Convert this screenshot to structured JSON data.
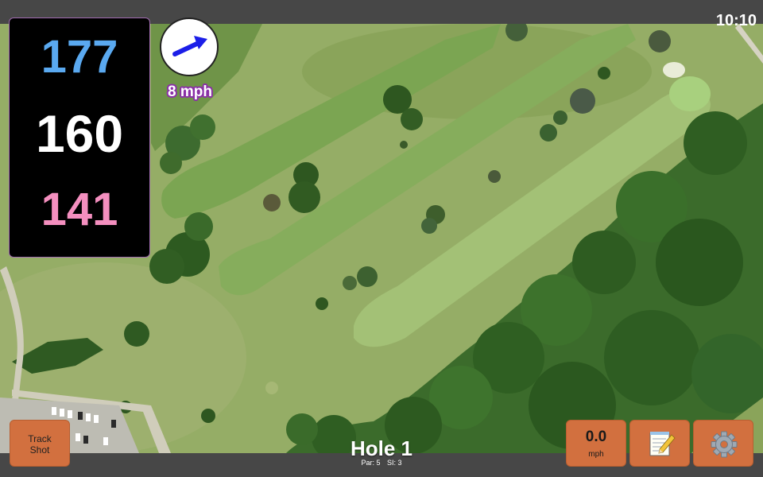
{
  "status": {
    "time": "10:10"
  },
  "distances": {
    "back": "177",
    "middle": "160",
    "front": "141"
  },
  "wind": {
    "speed_label": "8 mph",
    "direction_icon": "arrow-icon"
  },
  "hole": {
    "title": "Hole 1",
    "par_label": "Par: 5",
    "si_label": "SI: 3"
  },
  "buttons": {
    "track_shot_line1": "Track",
    "track_shot_line2": "Shot",
    "speed_value": "0.0",
    "speed_unit": "mph",
    "notes_icon": "notepad-icon",
    "settings_icon": "gear-icon"
  },
  "colors": {
    "back_distance": "#5aa9f0",
    "middle_distance": "#ffffff",
    "front_distance": "#f48fbf",
    "button": "#d2703f",
    "wind_label_outline": "#8b2fa8"
  }
}
